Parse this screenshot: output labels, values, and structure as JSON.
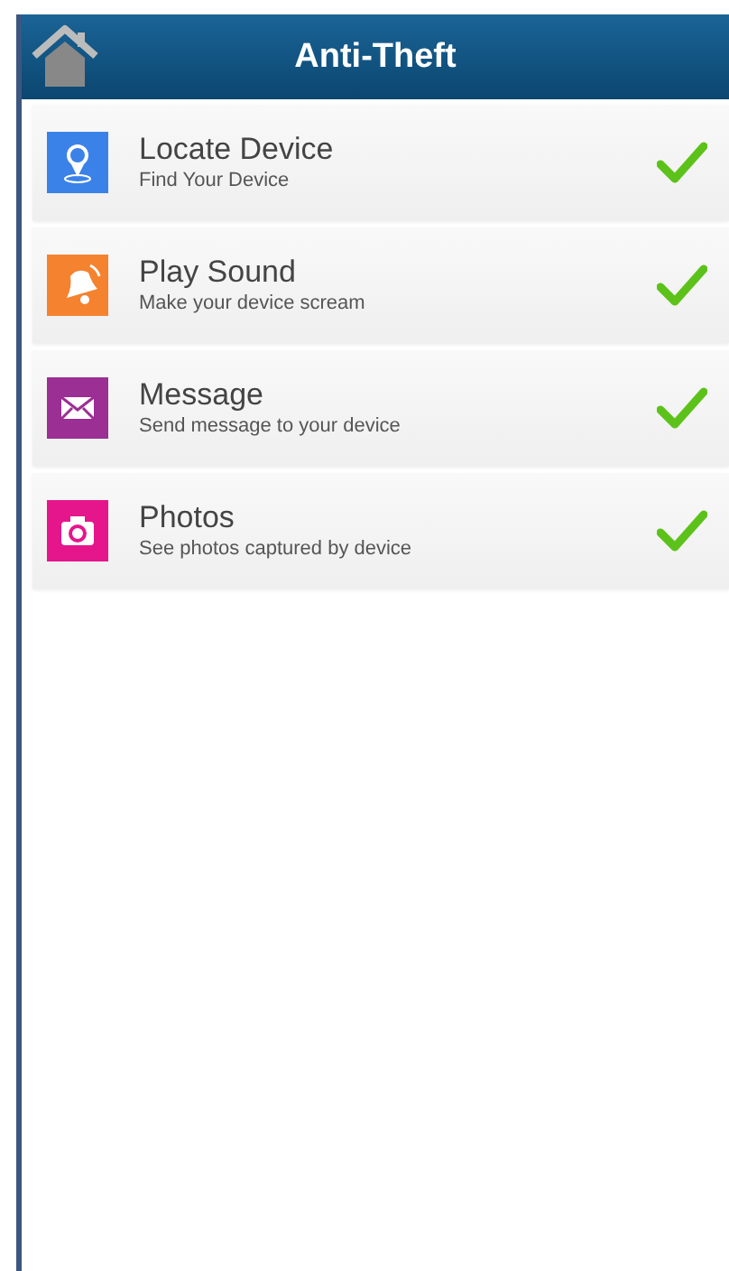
{
  "header": {
    "title": "Anti-Theft"
  },
  "items": [
    {
      "kind": "locate",
      "color": "#3b82e8",
      "title": "Locate Device",
      "subtitle": "Find Your Device",
      "checked": true
    },
    {
      "kind": "sound",
      "color": "#f5822f",
      "title": "Play Sound",
      "subtitle": "Make your device scream",
      "checked": true
    },
    {
      "kind": "message",
      "color": "#9b2f93",
      "title": "Message",
      "subtitle": "Send message to your device",
      "checked": true
    },
    {
      "kind": "photos",
      "color": "#e5168c",
      "title": "Photos",
      "subtitle": "See photos captured by device",
      "checked": true
    }
  ]
}
